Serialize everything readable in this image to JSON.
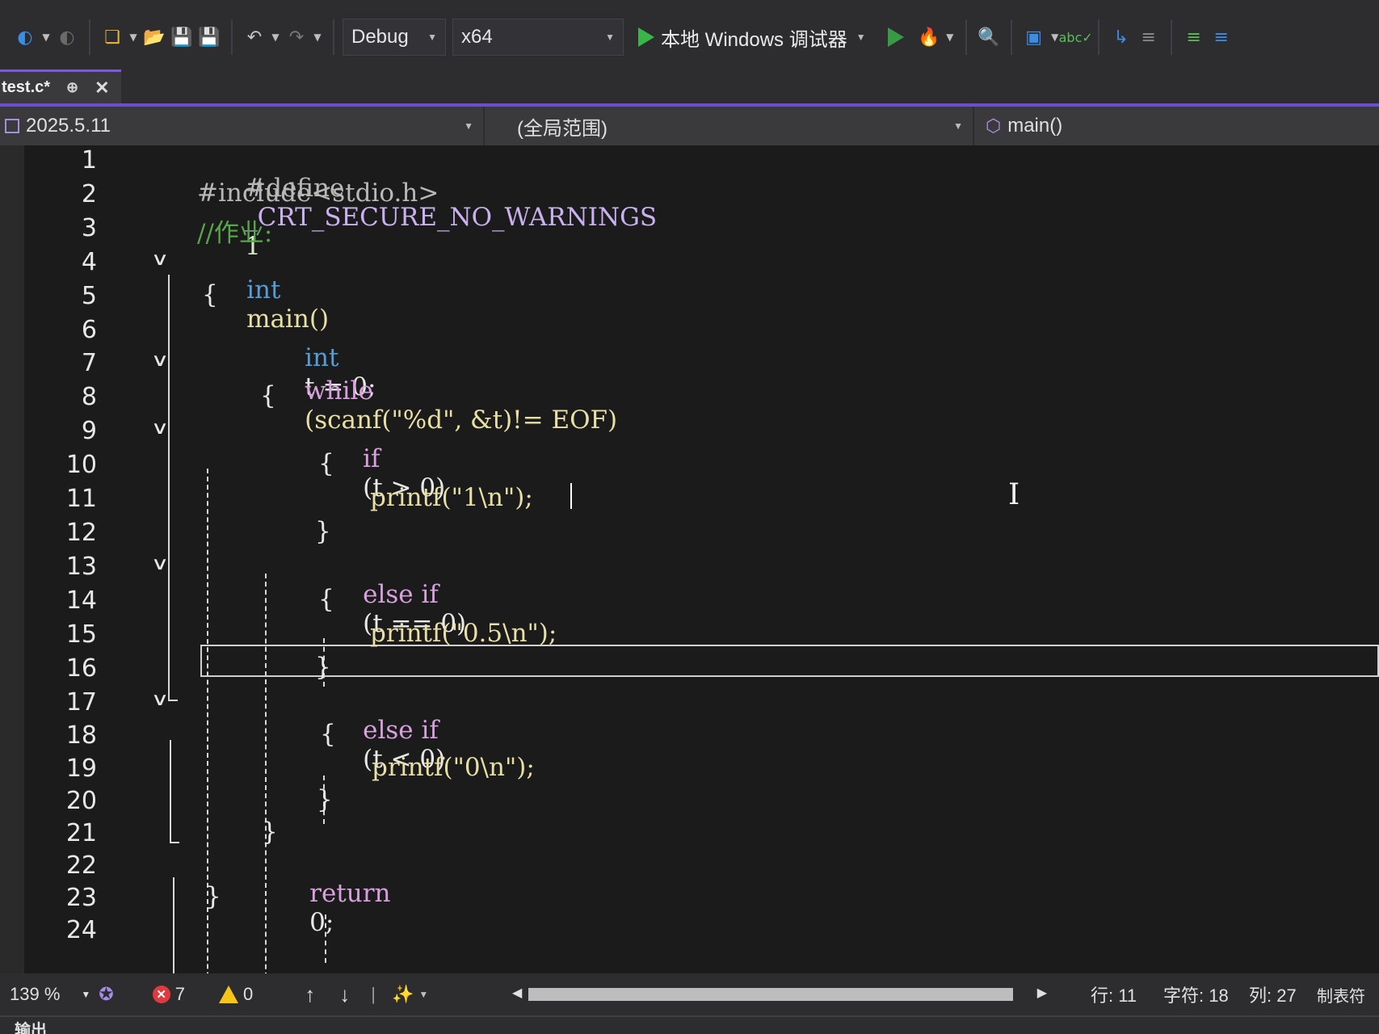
{
  "toolbar": {
    "config": "Debug",
    "platform": "x64",
    "run_label": "本地 Windows 调试器"
  },
  "tab": {
    "file": "test.c*"
  },
  "navbar": {
    "project": "2025.5.11",
    "scope": "(全局范围)",
    "member": "main()"
  },
  "code": {
    "line_numbers": [
      "1",
      "2",
      "3",
      "4",
      "5",
      "6",
      "7",
      "8",
      "9",
      "10",
      "11",
      "12",
      "13",
      "14",
      "15",
      "16",
      "17",
      "18",
      "19",
      "20",
      "21",
      "22",
      "23",
      "24"
    ],
    "l1_define": "#define",
    "l1_macro": "_CRT_SECURE_NO_WARNINGS",
    "l1_value": "1",
    "l2": "#include<stdio.h>",
    "l3": "//作业:",
    "l4_type": "int",
    "l4_name": "main()",
    "brace_open": "{",
    "brace_close": "}",
    "l6_type": "int",
    "l6_rest": "t = 0;",
    "l7_kw": "while",
    "l7_rest": "(scanf(\"%d\", &t)!= EOF)",
    "l9_kw": "if",
    "l9_rest": "(t > 0)",
    "l11": "printf(\"1\\n\");",
    "l13_kw": "else if",
    "l13_rest": "(t == 0)",
    "l15": "printf(\"0.5\\n\");",
    "l17_kw": "else if",
    "l17_rest": "(t < 0)",
    "l19": "printf(\"0\\n\");",
    "l22_kw": "return",
    "l22_rest": "0;"
  },
  "status": {
    "zoom": "139 %",
    "errors": "7",
    "warnings": "0",
    "line": "行: 11",
    "char": "字符: 18",
    "col": "列: 27",
    "tabs": "制表符"
  },
  "output": {
    "label": "输出"
  }
}
